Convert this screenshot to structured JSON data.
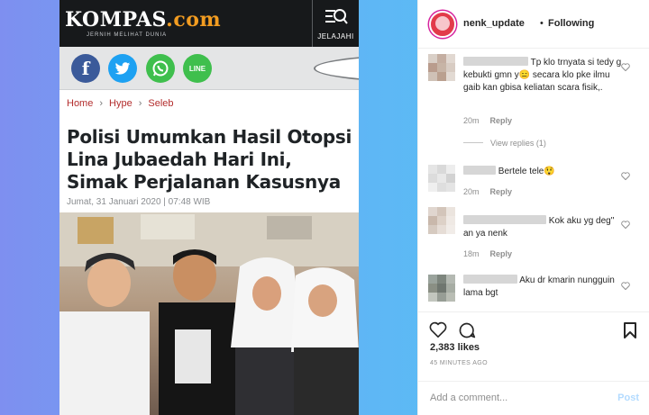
{
  "article": {
    "logo": "KOMPAS",
    "logo_suffix": ".com",
    "tagline": "JERNIH MELIHAT DUNIA",
    "explore_label": "JELAJAHI",
    "share_icons": [
      "facebook-icon",
      "twitter-icon",
      "whatsapp-icon",
      "line-icon",
      "comment-icon"
    ],
    "line_label": "LINE",
    "breadcrumb": [
      "Home",
      "Hype",
      "Seleb"
    ],
    "breadcrumb_sep": "›",
    "headline": "Polisi Umumkan Hasil Otopsi Lina Jubaedah Hari Ini, Simak Perjalanan Kasusnya",
    "dateline": "Jumat, 31 Januari 2020 | 07:48 WIB",
    "colors": {
      "header": "#17191b",
      "logo_dot": "#f29c21",
      "breadcrumb": "#b32d2d",
      "facebook": "#3b5a9a",
      "twitter": "#1da1f2",
      "whatsapp": "#3fbf4d"
    }
  },
  "instagram": {
    "username": "nenk_update",
    "separator": "•",
    "follow_status": "Following",
    "comments": [
      {
        "text": "Tp klo trnyata si tedy g kebukti gmn y😑 secara klo pke ilmu gaib kan gbisa keliatan scara fisik,.",
        "time": "20m",
        "reply": "Reply"
      },
      {
        "text": "Bertele tele😲",
        "time": "20m",
        "reply": "Reply"
      },
      {
        "text": "Kok aku yg deg\" an ya nenk",
        "time": "18m",
        "reply": "Reply"
      },
      {
        "text": "Aku dr kmarin nungguin lama bgt",
        "time": "",
        "reply": ""
      }
    ],
    "view_replies": "View replies (1)",
    "likes": "2,383 likes",
    "timestamp": "45 MINUTES AGO",
    "add_comment_placeholder": "Add a comment...",
    "post_label": "Post",
    "colors": {
      "link": "#b3dbff",
      "muted": "#8e8e8e",
      "text": "#262626"
    }
  }
}
